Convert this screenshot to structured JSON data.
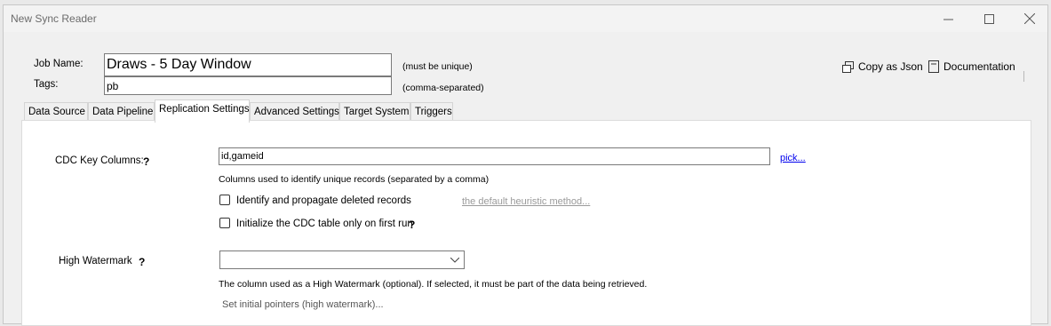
{
  "window": {
    "title": "New Sync Reader"
  },
  "job": {
    "name_label": "Job Name:",
    "name_value": "Draws - 5 Day Window",
    "name_hint": "(must be unique)",
    "tags_label": "Tags:",
    "tags_value": "pb",
    "tags_hint": "(comma-separated)"
  },
  "toolbar": {
    "copy_json_label": "Copy as Json",
    "documentation_label": "Documentation"
  },
  "tabs": [
    {
      "label": "Data Source"
    },
    {
      "label": "Data Pipeline"
    },
    {
      "label": "Replication Settings",
      "active": true
    },
    {
      "label": "Advanced Settings"
    },
    {
      "label": "Target System"
    },
    {
      "label": "Triggers"
    }
  ],
  "replication": {
    "cdc_key_label": "CDC Key Columns:",
    "cdc_key_help": "?",
    "cdc_key_value": "id,gameid",
    "pick_link": "pick...",
    "cdc_key_hint": "Columns used to identify unique records (separated by a comma)",
    "deleted_records_label": "Identify and propagate deleted records",
    "heuristic_link": "the default heuristic method...",
    "init_cdc_label": "Initialize the CDC table only on first run",
    "init_cdc_help": "?",
    "high_watermark_label": "High Watermark",
    "high_watermark_help": "?",
    "high_watermark_value": "",
    "high_watermark_hint": "The column used as a High Watermark (optional). If selected, it must be part of the data being retrieved.",
    "set_pointers_link": "Set initial pointers (high watermark)..."
  }
}
